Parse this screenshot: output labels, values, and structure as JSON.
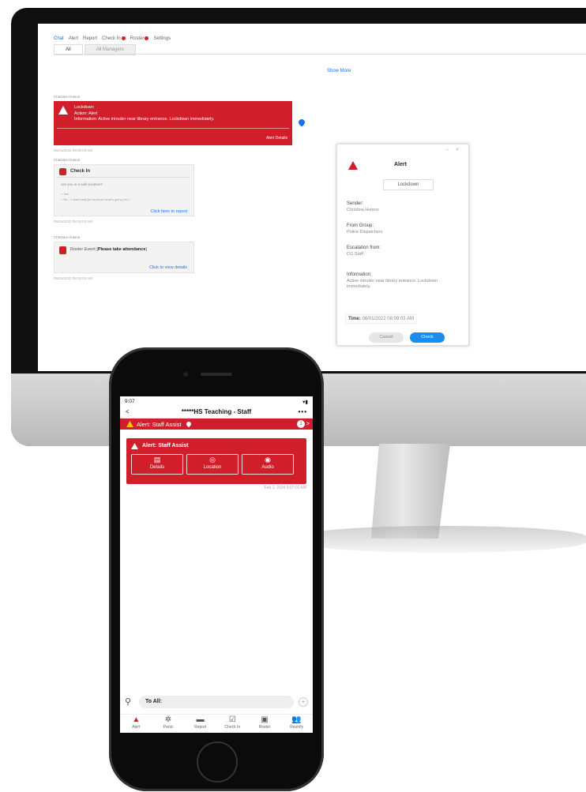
{
  "desktop": {
    "nav": [
      "Chat",
      "Alert",
      "Report",
      "Check In",
      "Roster",
      "Settings"
    ],
    "tabs": [
      "All",
      "All Managers"
    ],
    "show_more": "Show More",
    "messages": [
      {
        "sender": "Christina Hutson",
        "lines": [
          "Lockdown",
          "Action: Alert",
          "Information: Active intruder near library entrance. Lockdown immediately."
        ],
        "link": "Alert Details",
        "timestamp": "06/01/2022 08:09:03 AM"
      },
      {
        "sender": "Christina Hutson",
        "title": "Check In",
        "question": "Are you in a safe location?",
        "options": [
          "Yes",
          "No - I need help (let us know what's going on) i..."
        ],
        "link": "Click here to report",
        "timestamp": "06/01/2022 08:09:03 AM"
      },
      {
        "sender": "Christina Hutson",
        "title_prefix": "Roster Event [",
        "title_bold": "Please take attendance",
        "title_suffix": "]",
        "link": "Click to view details",
        "timestamp": "06/01/2022 08:09:04 AM"
      }
    ],
    "dialog": {
      "window_controls": "– ×",
      "title": "Alert",
      "type": "Lockdown",
      "fields": [
        {
          "label": "Sender:",
          "value": "Christina Hutson"
        },
        {
          "label": "From Group:",
          "value": "Police Dispatchers"
        },
        {
          "label": "Escalation from:",
          "value": "CG Staff"
        },
        {
          "label": "Information:",
          "value": "Active intruder near library entrance. Lockdown immediately."
        }
      ],
      "time_label": "Time:",
      "time_value": "06/01/2022 08:09:03 AM",
      "cancel": "Cancel",
      "check": "Check"
    }
  },
  "phone": {
    "status_time": "9:07",
    "status_right": "▾▮",
    "header_back": "<",
    "header_title": "*****HS Teaching - Staff",
    "header_more": "•••",
    "banner": "Alert: Staff Assist",
    "banner_count": "1",
    "banner_chevron": ">",
    "card_title": "Alert: Staff Assist",
    "actions": [
      {
        "label": "Details",
        "icon": "document-icon",
        "glyph": "▤"
      },
      {
        "label": "Location",
        "icon": "location-pin-icon",
        "glyph": "◎"
      },
      {
        "label": "Audio",
        "icon": "audio-icon",
        "glyph": "◉"
      }
    ],
    "timestamp": "Feb 1, 2024 9:07:02 AM",
    "composer_to": "To All:",
    "tabs": [
      {
        "label": "Alert",
        "icon": "alert-icon",
        "glyph": "▲"
      },
      {
        "label": "Panic",
        "icon": "panic-icon",
        "glyph": "✲"
      },
      {
        "label": "Report",
        "icon": "report-icon",
        "glyph": "▬"
      },
      {
        "label": "Check In",
        "icon": "check-in-icon",
        "glyph": "☑"
      },
      {
        "label": "Roster",
        "icon": "roster-icon",
        "glyph": "▣"
      },
      {
        "label": "Reunify",
        "icon": "reunify-icon",
        "glyph": "👥"
      }
    ]
  },
  "colors": {
    "alert_red": "#d01f2a",
    "link_blue": "#1a73e8",
    "warning_yellow": "#f3c600"
  }
}
